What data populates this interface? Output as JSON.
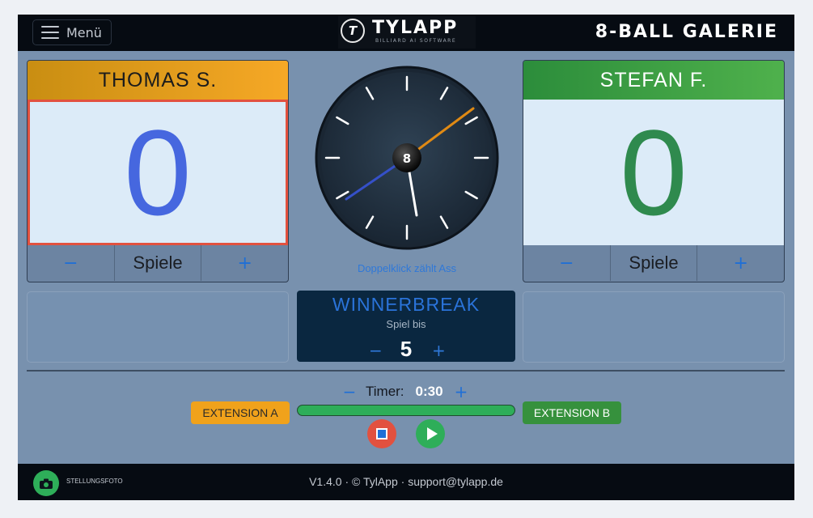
{
  "header": {
    "menu_label": "Menü",
    "logo_mark": "T",
    "logo_name": "TYLAPP",
    "logo_tagline": "BILLIARD AI SOFTWARE",
    "venue_title": "8-BALL GALERIE"
  },
  "players": [
    {
      "name": "THOMAS S.",
      "score": "0",
      "minus": "−",
      "unit_label": "Spiele",
      "plus": "+",
      "color": "#f6a826"
    },
    {
      "name": "STEFAN F.",
      "score": "0",
      "minus": "−",
      "unit_label": "Spiele",
      "plus": "+",
      "color": "#4fb14c"
    }
  ],
  "clock": {
    "ball_number": "8",
    "hint": "Doppelklick zählt Ass",
    "hour_hand": "blue",
    "minute_hand": "orange"
  },
  "winnerbreak": {
    "title": "WINNERBREAK",
    "subtitle": "Spiel bis",
    "minus": "−",
    "value": "5",
    "plus": "+"
  },
  "timer": {
    "minus": "−",
    "label": "Timer:",
    "value": "0:30",
    "plus": "+",
    "progress": 1.0
  },
  "extensions": {
    "a_label": "EXTENSION A",
    "b_label": "EXTENSION B"
  },
  "controls": {
    "stop_icon": "stop-icon",
    "play_icon": "play-icon"
  },
  "footer": {
    "camera_label": "STELLUNGSFOTO",
    "version_text": "V1.4.0 · © TylApp · support@tylapp.de"
  },
  "colors": {
    "background": "#7891ae",
    "accent_blue": "#1f6fd6",
    "alert_red": "#e2513f",
    "go_green": "#2eae59"
  }
}
